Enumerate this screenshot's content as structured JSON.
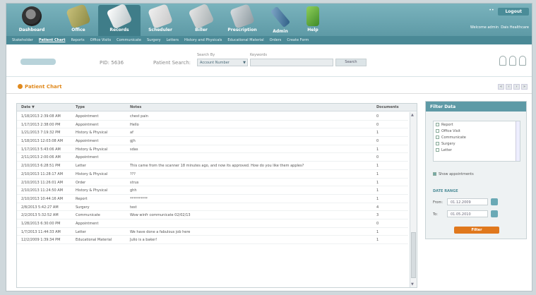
{
  "topnav": {
    "items": [
      {
        "label": "Dashboard",
        "icon": "dashboard-icon"
      },
      {
        "label": "Office",
        "icon": "office-icon"
      },
      {
        "label": "Records",
        "icon": "records-icon"
      },
      {
        "label": "Scheduler",
        "icon": "scheduler-icon"
      },
      {
        "label": "Biller",
        "icon": "biller-icon"
      },
      {
        "label": "Prescription",
        "icon": "prescription-icon"
      },
      {
        "label": "Admin",
        "icon": "admin-icon"
      },
      {
        "label": "Help",
        "icon": "help-icon"
      }
    ],
    "active_index": 2
  },
  "header": {
    "logout_label": "Logout",
    "welcome": "Welcome admin",
    "practice": "Dais Healthcare"
  },
  "subnav": {
    "items": [
      "Stakeholder",
      "Patient Chart",
      "Reports",
      "Office Visits",
      "Communicate",
      "Surgery",
      "Letters",
      "History and Physicals",
      "Educational Material",
      "Orders",
      "Create Form"
    ],
    "active_index": 1
  },
  "patient_search": {
    "pid_label": "PID: 5636",
    "search_label": "Patient Search:",
    "search_by_label": "Search By",
    "keywords_label": "Keywords",
    "search_by_value": "Account Number",
    "keywords_value": "",
    "search_button": "Search"
  },
  "chart": {
    "title": "Patient Chart",
    "controls": [
      "«",
      "‹",
      "›",
      "»"
    ]
  },
  "table": {
    "headers": {
      "date": "Date ▼",
      "type": "Type",
      "notes": "Notes",
      "docs": "Documents"
    },
    "rows": [
      {
        "date": "1/18/2013 2:39:08 AM",
        "type": "Appointment",
        "notes": "chest pain",
        "docs": "0"
      },
      {
        "date": "1/17/2013 2:38:00 PM",
        "type": "Appointment",
        "notes": "Hello",
        "docs": "0"
      },
      {
        "date": "1/21/2013 7:19:32 PM",
        "type": "History & Physical",
        "notes": "af",
        "docs": "1"
      },
      {
        "date": "1/18/2013 12:03:08 AM",
        "type": "Appointment",
        "notes": "gjh",
        "docs": "0"
      },
      {
        "date": "1/17/2013 5:43:06 AM",
        "type": "History & Physical",
        "notes": "sdas",
        "docs": "1"
      },
      {
        "date": "2/11/2013 2:00:06 AM",
        "type": "Appointment",
        "notes": "",
        "docs": "0"
      },
      {
        "date": "2/10/2013 6:28:51 PM",
        "type": "Letter",
        "notes": "This came from the scanner 18 minutes ago, and now its approved. How do you like them apples?",
        "docs": "1"
      },
      {
        "date": "2/10/2013 11:28:17 AM",
        "type": "History & Physical",
        "notes": "???",
        "docs": "1"
      },
      {
        "date": "2/10/2013 11:26:01 AM",
        "type": "Order",
        "notes": "strus",
        "docs": "1"
      },
      {
        "date": "2/10/2013 11:24:50 AM",
        "type": "History & Physical",
        "notes": "ghh",
        "docs": "1"
      },
      {
        "date": "2/10/2013 10:44:16 AM",
        "type": "Report",
        "notes": "**********",
        "docs": "1"
      },
      {
        "date": "2/8/2013 5:42:27 AM",
        "type": "Surgery",
        "notes": "test",
        "docs": "4"
      },
      {
        "date": "2/2/2013 5:32:52 AM",
        "type": "Communicate",
        "notes": "Wow winfr communicate 02/02/13",
        "docs": "3"
      },
      {
        "date": "1/28/2013 6:30:00 PM",
        "type": "Appointment",
        "notes": "",
        "docs": "0"
      },
      {
        "date": "1/7/2013 11:44:33 AM",
        "type": "Letter",
        "notes": "We have done a fabulous job here",
        "docs": "1"
      },
      {
        "date": "12/2/2009 1:39:34 PM",
        "type": "Educational Material",
        "notes": "Julio is a baker!",
        "docs": "1"
      }
    ]
  },
  "filter": {
    "title": "Filter Data",
    "options": [
      {
        "label": "Report",
        "checked": false
      },
      {
        "label": "Office Visit",
        "checked": false
      },
      {
        "label": "Communicate",
        "checked": false
      },
      {
        "label": "Surgery",
        "checked": false
      },
      {
        "label": "Letter",
        "checked": false
      }
    ],
    "show_appointments": "Show appointments",
    "date_range_label": "DATE RANGE",
    "from_label": "From:",
    "from_value": "01.12.2009",
    "to_label": "To:",
    "to_value": "01.05.2010",
    "button": "Filter"
  }
}
